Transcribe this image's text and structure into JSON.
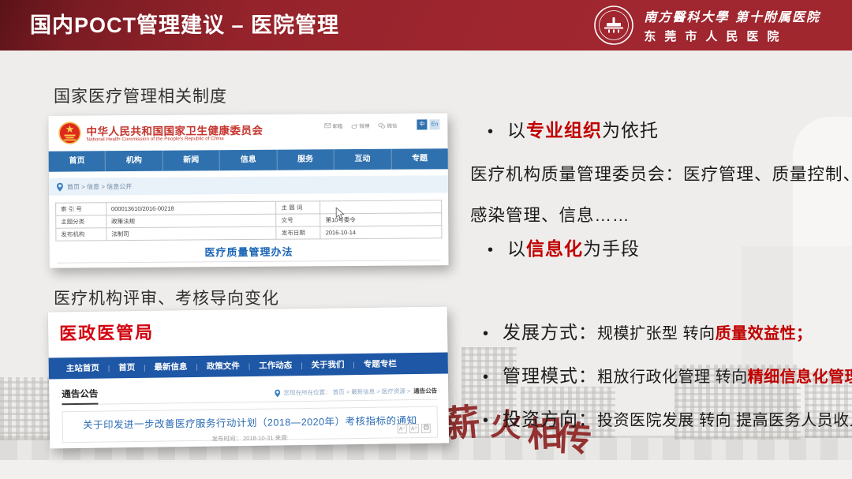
{
  "header": {
    "title": "国内POCT管理建议 – 医院管理",
    "hospital_line1": "南方醫科大學 第十附属医院",
    "hospital_line2": "东莞市人民医院"
  },
  "section1": {
    "heading": "国家医疗管理相关制度",
    "nhc": {
      "name_cn": "中华人民共和国国家卫生健康委员会",
      "name_en": "National Health Commission of the People's Republic of China",
      "toolbar": {
        "mail": "邮箱",
        "weibo": "微博",
        "wechat": "微信",
        "lang_cn": "中",
        "lang_en": "En"
      },
      "nav": [
        "首页",
        "机构",
        "新闻",
        "信息",
        "服务",
        "互动",
        "专题"
      ],
      "breadcrumb": "首页 > 信息 > 信息公开",
      "table": {
        "r1": {
          "l1": "索 引 号",
          "v1": "000013610/2016-00218",
          "l2": "主 题 词",
          "v2": ""
        },
        "r2": {
          "l1": "主题分类",
          "v1": "政策法规",
          "l2": "文号",
          "v2": "第10号委令"
        },
        "r3": {
          "l1": "发布机构",
          "v1": "法制司",
          "l2": "发布日期",
          "v2": "2016-10-14"
        }
      },
      "doc_link": "医疗质量管理办法"
    }
  },
  "section2": {
    "heading": "医疗机构评审、考核导向变化",
    "yzyg": {
      "name": "医政医管局",
      "nav": [
        "主站首页",
        "首页",
        "最新信息",
        "政策文件",
        "工作动态",
        "关于我们",
        "专题专栏"
      ],
      "nav_sep": "|",
      "board_label": "通告公告",
      "breadcrumb_prefix": "您现在所在位置： 首页 > 最新信息 > 医疗资源 >",
      "breadcrumb_current": "通告公告",
      "notice_title": "关于印发进一步改善医疗服务行动计划（2018—2020年）考核指标的通知",
      "meta": "发布时间： 2018-10-31  来源:",
      "btn_small": "A⁻",
      "btn_large": "A⁺"
    }
  },
  "bullets": {
    "glyph": "•",
    "b1": {
      "pre": "以",
      "hl": "专业组织",
      "post": "为依托"
    },
    "para1": "医疗机构质量管理委员会：医疗管理、质量控制、医院",
    "para2": "感染管理、信息……",
    "b2": {
      "pre": "以",
      "hl": "信息化",
      "post": "为手段"
    },
    "b3": {
      "label": "发展方式：",
      "normal": "规模扩张型 转向 ",
      "hl": "质量效益性；"
    },
    "b4": {
      "label": "管理模式：",
      "normal": "粗放行政化管理 转向 ",
      "hl": "精细信息化管理"
    },
    "b5": {
      "label": "投资方向：",
      "normal": "投资医院发展 转向 提高医务人员收入",
      "hl": ""
    }
  },
  "watermark": {
    "c1": "薪",
    "c2": "火",
    "c3": "相",
    "c4": "传"
  },
  "colors": {
    "accent": "#c00000",
    "header_red": "#9d262e",
    "nhc_blue": "#2f71ae",
    "yz_blue": "#1e57a5",
    "link_blue": "#1b66b5",
    "nhc_red": "#c5352e",
    "yz_red": "#d2020f"
  }
}
